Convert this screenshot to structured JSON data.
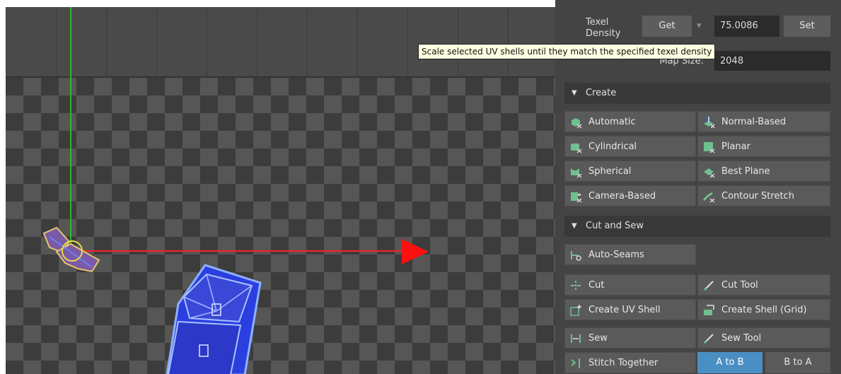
{
  "texel": {
    "label_line1": "Texel",
    "label_line2": "Density",
    "get_label": "Get",
    "dropdown_glyph": "▾",
    "value": "75.0086",
    "set_label": "Set"
  },
  "map_size": {
    "label": "Map Size:",
    "value": "2048"
  },
  "tooltip": "Scale selected UV shells until they match the specified texel density",
  "create": {
    "title": "Create",
    "items": [
      {
        "label": "Automatic",
        "icon": "automatic-icon"
      },
      {
        "label": "Normal-Based",
        "icon": "normal-based-icon"
      },
      {
        "label": "Cylindrical",
        "icon": "cylindrical-icon"
      },
      {
        "label": "Planar",
        "icon": "planar-icon"
      },
      {
        "label": "Spherical",
        "icon": "spherical-icon"
      },
      {
        "label": "Best Plane",
        "icon": "best-plane-icon"
      },
      {
        "label": "Camera-Based",
        "icon": "camera-based-icon"
      },
      {
        "label": "Contour Stretch",
        "icon": "contour-stretch-icon"
      }
    ]
  },
  "cut_sew": {
    "title": "Cut and Sew",
    "auto_seams": "Auto-Seams",
    "cut": "Cut",
    "cut_tool": "Cut Tool",
    "create_uv_shell": "Create UV Shell",
    "create_shell_grid": "Create Shell (Grid)",
    "sew": "Sew",
    "sew_tool": "Sew Tool",
    "stitch_together": "Stitch Together",
    "a_to_b": "A to B",
    "b_to_a": "B to A"
  },
  "colors": {
    "accent": "#4a8fc4",
    "x_axis": "#ff2020",
    "y_axis": "#2fb82f",
    "uv_shell": "#3a3ad8",
    "tooltip_bg": "#ffffe1"
  }
}
